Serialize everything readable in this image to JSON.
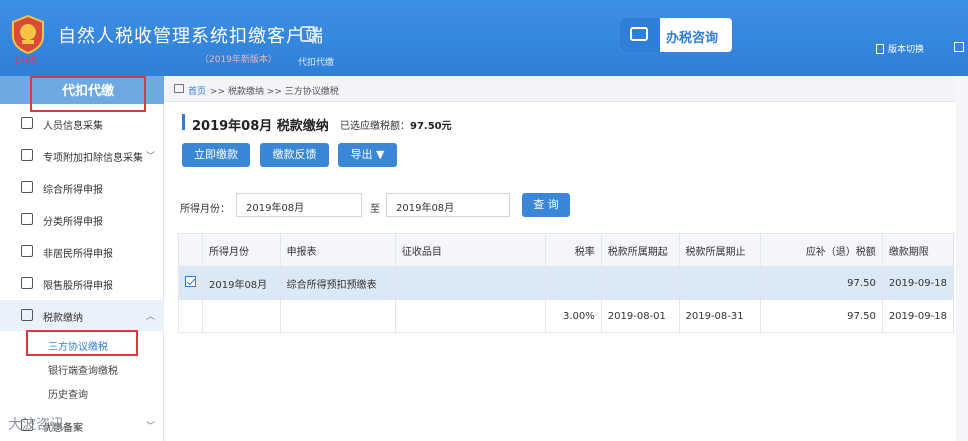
{
  "header": {
    "app_title": "自然人税收管理系统扣缴客户端",
    "version": "（2019年新版本）",
    "stamp": "1405",
    "proxy_label": "代扣代缴",
    "consult_label": "办税咨询",
    "version_switch": "版本切换"
  },
  "sidebar": {
    "section_title": "代扣代缴",
    "items": [
      {
        "label": "人员信息采集",
        "icon": "person-icon"
      },
      {
        "label": "专项附加扣除信息采集",
        "icon": "grid-icon"
      },
      {
        "label": "综合所得申报",
        "icon": "layers-icon"
      },
      {
        "label": "分类所得申报",
        "icon": "pie-icon"
      },
      {
        "label": "非居民所得申报",
        "icon": "user-icon"
      },
      {
        "label": "限售股所得申报",
        "icon": "bar-icon"
      },
      {
        "label": "税款缴纳",
        "icon": "folder-icon"
      },
      {
        "label": "优惠备案",
        "icon": "tag-icon"
      }
    ],
    "sub_items": [
      "三方协议缴税",
      "银行端查询缴税",
      "历史查询"
    ]
  },
  "breadcrumb": {
    "home": "首页",
    "rest": ">> 税款缴纳 >> 三方协议缴税"
  },
  "main": {
    "title": "2019年08月 税款缴纳",
    "selected_label": "已选应缴税额：",
    "selected_amount": "97.50元",
    "buttons": {
      "pay_now": "立即缴款",
      "feedback": "缴款反馈",
      "export": "导出 ▼",
      "query": "查 询"
    },
    "filter": {
      "label": "所得月份：",
      "from": "2019年08月",
      "to_label": "至",
      "to": "2019年08月"
    },
    "table": {
      "headers": [
        "",
        "所得月份",
        "申报表",
        "征收品目",
        "税率",
        "税款所属期起",
        "税款所属期止",
        "应补（退）税额",
        "缴款期限"
      ],
      "rows": [
        [
          "",
          "2019年08月",
          "综合所得预扣预缴表",
          "",
          "",
          "",
          "",
          "97.50",
          "2019-09-18"
        ],
        [
          "",
          "",
          "",
          "",
          "3.00%",
          "2019-08-01",
          "2019-08-31",
          "97.50",
          "2019-09-18"
        ]
      ]
    }
  },
  "watermark": "大波咨讯"
}
